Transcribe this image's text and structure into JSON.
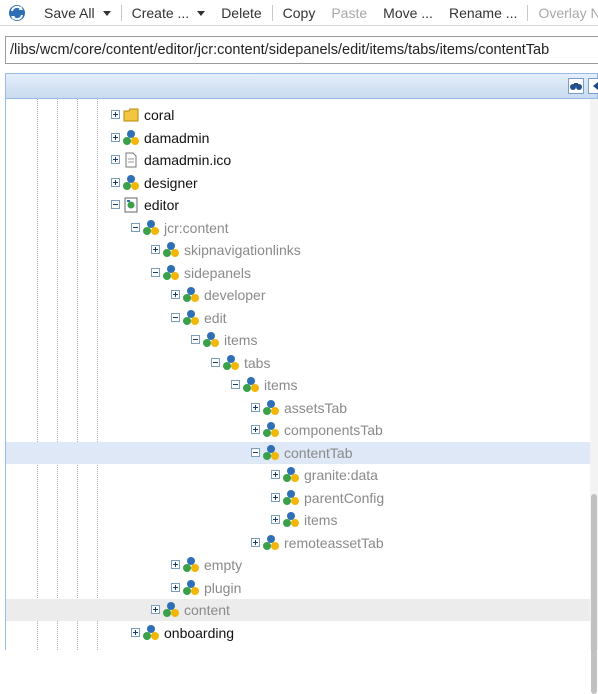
{
  "toolbar": {
    "items": [
      {
        "label": "Save All",
        "dropdown": true,
        "disabled": false,
        "name": "save-all-button"
      },
      {
        "label": "Create ...",
        "dropdown": true,
        "disabled": false,
        "name": "create-button"
      },
      {
        "label": "Delete",
        "dropdown": false,
        "disabled": false,
        "name": "delete-button"
      },
      {
        "label": "Copy",
        "dropdown": false,
        "disabled": false,
        "name": "copy-button"
      },
      {
        "label": "Paste",
        "dropdown": false,
        "disabled": true,
        "name": "paste-button"
      },
      {
        "label": "Move ...",
        "dropdown": false,
        "disabled": false,
        "name": "move-button"
      },
      {
        "label": "Rename ...",
        "dropdown": false,
        "disabled": false,
        "name": "rename-button"
      },
      {
        "label": "Overlay N",
        "dropdown": false,
        "disabled": true,
        "name": "overlay-node-button"
      }
    ]
  },
  "path": {
    "value": "/libs/wcm/core/content/editor/jcr:content/sidepanels/edit/items/tabs/items/contentTab"
  },
  "colors": {
    "selected_row": "#dfe8f6",
    "hover_row": "#ececec",
    "panel_header": "#c9dbf0",
    "dark_text": "#111111",
    "grey_text": "#8a8a8a"
  },
  "tree": {
    "rows": [
      {
        "label": "coral",
        "depth": 0,
        "expander": "plus",
        "icon": "folder-icon",
        "tone": "dark"
      },
      {
        "label": "damadmin",
        "depth": 0,
        "expander": "plus",
        "icon": "node-icon",
        "tone": "dark"
      },
      {
        "label": "damadmin.ico",
        "depth": 0,
        "expander": "plus",
        "icon": "file-icon",
        "tone": "dark"
      },
      {
        "label": "designer",
        "depth": 0,
        "expander": "plus",
        "icon": "node-icon",
        "tone": "dark"
      },
      {
        "label": "editor",
        "depth": 0,
        "expander": "minus",
        "icon": "page-icon",
        "tone": "dark"
      },
      {
        "label": "jcr:content",
        "depth": 1,
        "expander": "minus",
        "icon": "node-icon",
        "tone": "grey"
      },
      {
        "label": "skipnavigationlinks",
        "depth": 2,
        "expander": "plus",
        "icon": "node-icon",
        "tone": "grey"
      },
      {
        "label": "sidepanels",
        "depth": 2,
        "expander": "minus",
        "icon": "node-icon",
        "tone": "grey"
      },
      {
        "label": "developer",
        "depth": 3,
        "expander": "plus",
        "icon": "node-icon",
        "tone": "grey"
      },
      {
        "label": "edit",
        "depth": 3,
        "expander": "minus",
        "icon": "node-icon",
        "tone": "grey"
      },
      {
        "label": "items",
        "depth": 4,
        "expander": "minus",
        "icon": "node-icon",
        "tone": "grey"
      },
      {
        "label": "tabs",
        "depth": 5,
        "expander": "minus",
        "icon": "node-icon",
        "tone": "grey"
      },
      {
        "label": "items",
        "depth": 6,
        "expander": "minus",
        "icon": "node-icon",
        "tone": "grey"
      },
      {
        "label": "assetsTab",
        "depth": 7,
        "expander": "plus",
        "icon": "node-icon",
        "tone": "grey"
      },
      {
        "label": "componentsTab",
        "depth": 7,
        "expander": "plus",
        "icon": "node-icon",
        "tone": "grey"
      },
      {
        "label": "contentTab",
        "depth": 7,
        "expander": "minus",
        "icon": "node-icon",
        "tone": "grey",
        "state": "selected"
      },
      {
        "label": "granite:data",
        "depth": 8,
        "expander": "plus",
        "icon": "node-icon",
        "tone": "grey"
      },
      {
        "label": "parentConfig",
        "depth": 8,
        "expander": "plus",
        "icon": "node-icon",
        "tone": "grey"
      },
      {
        "label": "items",
        "depth": 8,
        "expander": "plus",
        "icon": "node-icon",
        "tone": "grey"
      },
      {
        "label": "remoteassetTab",
        "depth": 7,
        "expander": "plus",
        "icon": "node-icon",
        "tone": "grey"
      },
      {
        "label": "empty",
        "depth": 3,
        "expander": "plus",
        "icon": "node-icon",
        "tone": "grey"
      },
      {
        "label": "plugin",
        "depth": 3,
        "expander": "plus",
        "icon": "node-icon",
        "tone": "grey"
      },
      {
        "label": "content",
        "depth": 2,
        "expander": "plus",
        "icon": "node-icon",
        "tone": "grey",
        "state": "hover"
      },
      {
        "label": "onboarding",
        "depth": 1,
        "expander": "plus",
        "icon": "node-icon",
        "tone": "dark"
      }
    ]
  }
}
